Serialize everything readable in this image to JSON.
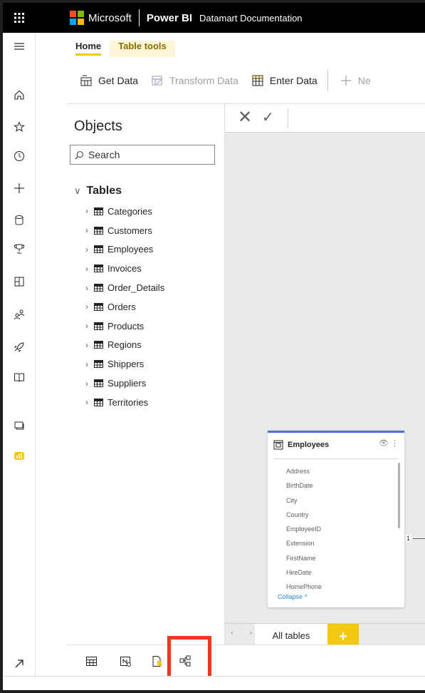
{
  "header": {
    "brand": "Microsoft",
    "product": "Power BI",
    "document": "Datamart Documentation",
    "logo_colors": [
      "#f25022",
      "#7fba00",
      "#00a4ef",
      "#ffb900"
    ]
  },
  "ribbon": {
    "tabs": [
      {
        "label": "Home"
      },
      {
        "label": "Table tools"
      }
    ],
    "buttons": {
      "get_data": "Get Data",
      "transform_data": "Transform Data",
      "enter_data": "Enter Data",
      "new": "Ne"
    }
  },
  "rail": {
    "icons": [
      "menu-icon",
      "home-icon",
      "favorites-icon",
      "recent-icon",
      "create-icon",
      "datasets-icon",
      "goals-icon",
      "apps-icon",
      "shared-icon",
      "deployment-icon",
      "learn-icon",
      "workspaces-icon",
      "datamart-icon",
      "expand-icon"
    ]
  },
  "objects": {
    "title": "Objects",
    "search_placeholder": "Search",
    "group_label": "Tables",
    "tables": [
      "Categories",
      "Customers",
      "Employees",
      "Invoices",
      "Order_Details",
      "Orders",
      "Products",
      "Regions",
      "Shippers",
      "Suppliers",
      "Territories"
    ]
  },
  "formula_bar": {
    "cancel": "✕",
    "commit": "✓"
  },
  "model_card": {
    "table": "Employees",
    "actions": "👁 ⋮",
    "fields": [
      "Address",
      "BirthDate",
      "City",
      "Country",
      "EmployeeID",
      "Extension",
      "FirstName",
      "HireDate",
      "HomePhone"
    ],
    "collapse_label": "Collapse ^",
    "relationship_cardinality": "1"
  },
  "pages": {
    "nav": "‹ ›",
    "active_tab": "All tables",
    "add": "+"
  },
  "views": [
    "data-view-icon",
    "query-view-icon",
    "dax-view-icon",
    "model-view-icon"
  ],
  "colors": {
    "accent": "#f2c811",
    "highlight": "#e63b1f",
    "card_accent": "#3d7ad8"
  }
}
